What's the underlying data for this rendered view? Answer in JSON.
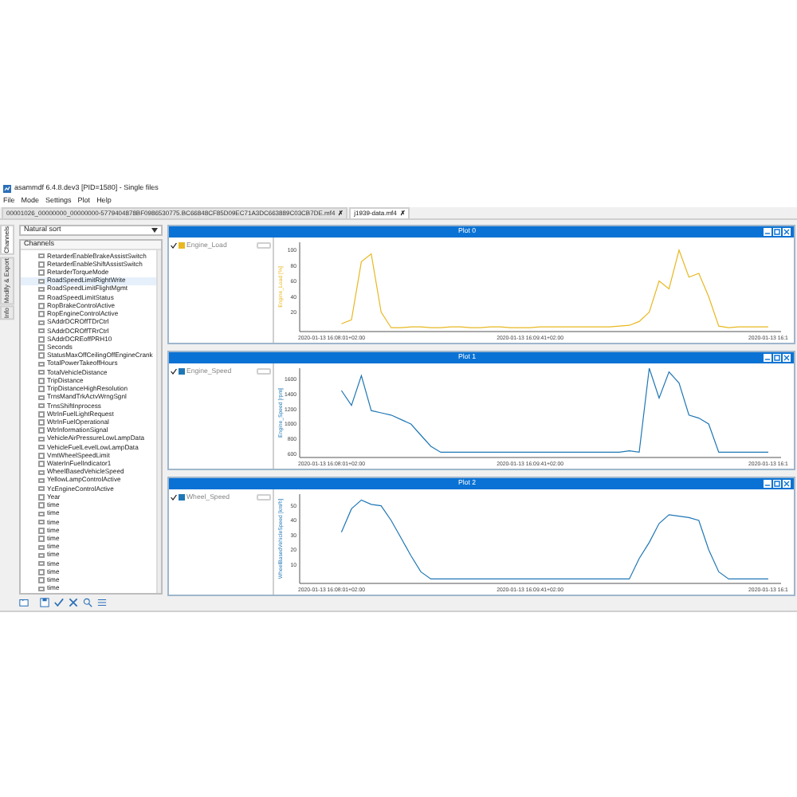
{
  "window": {
    "title": "asammdf 6.4.8.dev3 [PID=1580] - Single files"
  },
  "menu": [
    "File",
    "Mode",
    "Settings",
    "Plot",
    "Help"
  ],
  "file_tabs": [
    {
      "label": "00001026_00000000_00000000-5779404878BF0986530775.BC66848CF85D09EC71A3DC663889C03CB7DE.mf4",
      "selected": false,
      "close": "✗"
    },
    {
      "label": "j1939-data.mf4",
      "selected": true,
      "close": "✗"
    }
  ],
  "side_tabs": [
    {
      "label": "Channels",
      "selected": true
    },
    {
      "label": "Modify & Export",
      "selected": false
    },
    {
      "label": "Info",
      "selected": false
    }
  ],
  "channel_panel": {
    "sort": "Natural sort",
    "header": "Channels",
    "channels": [
      {
        "name": "RetarderEnableBrakeAssistSwitch",
        "checked": false,
        "selected": false
      },
      {
        "name": "RetarderEnableShiftAssistSwitch",
        "checked": false,
        "selected": false
      },
      {
        "name": "RetarderTorqueMode",
        "checked": false,
        "selected": false
      },
      {
        "name": "RoadSpeedLimitRightWrite",
        "checked": false,
        "selected": true
      },
      {
        "name": "RoadSpeedLimitFlightMgmt",
        "checked": false,
        "selected": false
      },
      {
        "name": "RoadSpeedLimitStatus",
        "checked": false,
        "selected": false
      },
      {
        "name": "RopBrakeControlActive",
        "checked": false,
        "selected": false
      },
      {
        "name": "RopEngineControlActive",
        "checked": false,
        "selected": false
      },
      {
        "name": "SAddrDCROffTDrCtrl",
        "checked": false,
        "selected": false
      },
      {
        "name": "SAddrDCROffTRrCtrl",
        "checked": false,
        "selected": false
      },
      {
        "name": "SAddrDCREoffPRH10",
        "checked": false,
        "selected": false
      },
      {
        "name": "Seconds",
        "checked": false,
        "selected": false
      },
      {
        "name": "StatusMaxOffCeilingOffEngineCrank",
        "checked": false,
        "selected": false
      },
      {
        "name": "TotalPowerTakeoffHours",
        "checked": false,
        "selected": false
      },
      {
        "name": "TotalVehicleDistance",
        "checked": false,
        "selected": false
      },
      {
        "name": "TripDistance",
        "checked": false,
        "selected": false
      },
      {
        "name": "TripDistanceHighResolution",
        "checked": false,
        "selected": false
      },
      {
        "name": "TrnsMandTrkActvWrngSgnl",
        "checked": false,
        "selected": false
      },
      {
        "name": "TrnsShiftInprocess",
        "checked": false,
        "selected": false
      },
      {
        "name": "WtrInFuelLightRequest",
        "checked": false,
        "selected": false
      },
      {
        "name": "WtrInFuelOperational",
        "checked": false,
        "selected": false
      },
      {
        "name": "WtrInformationSignal",
        "checked": false,
        "selected": false
      },
      {
        "name": "VehicleAirPressureLowLampData",
        "checked": false,
        "selected": false
      },
      {
        "name": "VehicleFuelLevelLowLampData",
        "checked": false,
        "selected": false
      },
      {
        "name": "VmtWheelSpeedLimit",
        "checked": false,
        "selected": false
      },
      {
        "name": "WaterInFuelIndicator1",
        "checked": false,
        "selected": false
      },
      {
        "name": "WheelBasedVehicleSpeed",
        "checked": false,
        "selected": false
      },
      {
        "name": "YellowLampControlActive",
        "checked": false,
        "selected": false
      },
      {
        "name": "YcEngineControlActive",
        "checked": false,
        "selected": false
      },
      {
        "name": "Year",
        "checked": false,
        "selected": false
      },
      {
        "name": "time",
        "checked": false,
        "selected": false
      },
      {
        "name": "time",
        "checked": false,
        "selected": false
      },
      {
        "name": "time",
        "checked": false,
        "selected": false
      },
      {
        "name": "time",
        "checked": false,
        "selected": false
      },
      {
        "name": "time",
        "checked": false,
        "selected": false
      },
      {
        "name": "time",
        "checked": false,
        "selected": false
      },
      {
        "name": "time",
        "checked": false,
        "selected": false
      },
      {
        "name": "time",
        "checked": false,
        "selected": false
      },
      {
        "name": "time",
        "checked": false,
        "selected": false
      },
      {
        "name": "time",
        "checked": false,
        "selected": false
      },
      {
        "name": "time",
        "checked": false,
        "selected": false
      }
    ]
  },
  "plots": [
    {
      "title": "Plot 0",
      "legend": [
        {
          "name": "Engine_Load",
          "checked": true,
          "color": "#e8b820"
        }
      ],
      "chart_data": {
        "type": "line",
        "ylabel": "Engine_Load [%]",
        "categories": [
          "2020-01-13 16:08:01+02:00",
          null,
          null,
          null,
          null,
          null,
          null,
          null,
          null,
          null,
          null,
          null,
          null,
          null,
          null,
          null,
          null,
          null,
          null,
          null,
          "2020-01-13 16:09:41+02:00",
          null,
          null,
          null,
          null,
          null,
          null,
          null,
          null,
          null,
          null,
          null,
          null,
          null,
          null,
          null,
          null,
          null,
          null,
          null,
          null,
          null,
          null,
          null,
          "2020-01-13 16:1"
        ],
        "ylim": [
          -5,
          110
        ],
        "yticks": [
          20,
          40,
          60,
          80,
          100
        ],
        "series": [
          {
            "color": "#e8b820",
            "values": [
              null,
              5,
              10,
              85,
              95,
              20,
              0,
              0,
              1,
              1,
              0,
              0,
              1,
              1,
              0,
              0,
              1,
              1,
              0,
              0,
              0,
              1,
              1,
              1,
              1,
              1,
              1,
              1,
              1,
              2,
              3,
              8,
              20,
              60,
              50,
              100,
              65,
              70,
              40,
              2,
              0,
              1,
              1,
              1,
              1
            ]
          }
        ]
      }
    },
    {
      "title": "Plot 1",
      "legend": [
        {
          "name": "Engine_Speed",
          "checked": true,
          "color": "#1f77b4"
        }
      ],
      "chart_data": {
        "type": "line",
        "ylabel": "Engine_Speed [rpm]",
        "categories": [
          "2020-01-13 16:08:01+02:00",
          null,
          null,
          null,
          null,
          null,
          null,
          null,
          null,
          null,
          null,
          null,
          null,
          null,
          null,
          null,
          null,
          null,
          null,
          null,
          "2020-01-13 16:09:41+02:00",
          null,
          null,
          null,
          null,
          null,
          null,
          null,
          null,
          null,
          null,
          null,
          null,
          null,
          null,
          null,
          null,
          null,
          null,
          null,
          null,
          null,
          null,
          null,
          "2020-01-13 16:1"
        ],
        "ylim": [
          550,
          1750
        ],
        "yticks": [
          600,
          800,
          1000,
          1200,
          1400,
          1600
        ],
        "series": [
          {
            "color": "#1f77b4",
            "values": [
              null,
              1450,
              1250,
              1650,
              1180,
              1150,
              1120,
              1060,
              1000,
              850,
              700,
              620,
              620,
              620,
              620,
              620,
              620,
              620,
              620,
              620,
              620,
              620,
              620,
              620,
              620,
              620,
              620,
              620,
              620,
              620,
              640,
              620,
              1750,
              1350,
              1700,
              1550,
              1120,
              1080,
              1000,
              620,
              620,
              620,
              620,
              620,
              620
            ]
          }
        ]
      }
    },
    {
      "title": "Plot 2",
      "legend": [
        {
          "name": "Wheel_Speed",
          "checked": true,
          "color": "#1f77b4"
        }
      ],
      "chart_data": {
        "type": "line",
        "ylabel": "WheelBasedVehicleSpeed [km/h]",
        "categories": [
          "2020-01-13 16:08:01+02:00",
          null,
          null,
          null,
          null,
          null,
          null,
          null,
          null,
          null,
          null,
          null,
          null,
          null,
          null,
          null,
          null,
          null,
          null,
          null,
          "2020-01-13 16:09:41+02:00",
          null,
          null,
          null,
          null,
          null,
          null,
          null,
          null,
          null,
          null,
          null,
          null,
          null,
          null,
          null,
          null,
          null,
          null,
          null,
          null,
          null,
          null,
          null,
          "2020-01-13 16:1"
        ],
        "ylim": [
          -3,
          58
        ],
        "yticks": [
          10,
          20,
          30,
          40,
          50
        ],
        "series": [
          {
            "color": "#1f77b4",
            "values": [
              null,
              32,
              48,
              54,
              51,
              50,
              40,
              28,
              16,
              5,
              0,
              0,
              0,
              0,
              0,
              0,
              0,
              0,
              0,
              0,
              0,
              0,
              0,
              0,
              0,
              0,
              0,
              0,
              0,
              0,
              0,
              14,
              25,
              38,
              44,
              43,
              42,
              40,
              20,
              5,
              0,
              0,
              0,
              0,
              0
            ]
          }
        ]
      }
    }
  ]
}
